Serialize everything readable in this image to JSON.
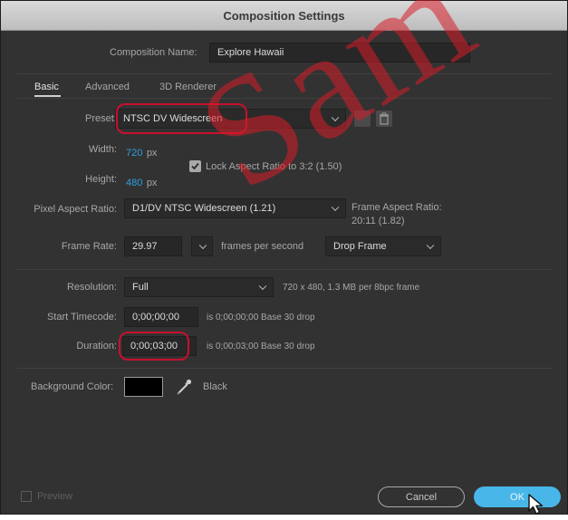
{
  "window": {
    "title": "Composition Settings"
  },
  "composition_name": {
    "label": "Composition Name:",
    "value": "Explore Hawaii"
  },
  "tabs": [
    {
      "label": "Basic",
      "active": true
    },
    {
      "label": "Advanced",
      "active": false
    },
    {
      "label": "3D Renderer",
      "active": false
    }
  ],
  "preset": {
    "label": "Preset:",
    "value": "NTSC DV Widescreen"
  },
  "width": {
    "label": "Width:",
    "value": "720",
    "unit": "px"
  },
  "height": {
    "label": "Height:",
    "value": "480",
    "unit": "px"
  },
  "lock_aspect": {
    "label": "Lock Aspect Ratio to 3:2 (1.50)",
    "checked": true
  },
  "pixel_aspect": {
    "label": "Pixel Aspect Ratio:",
    "value": "D1/DV NTSC Widescreen (1.21)"
  },
  "frame_aspect": {
    "label": "Frame Aspect Ratio:",
    "value": "20:11 (1.82)"
  },
  "frame_rate": {
    "label": "Frame Rate:",
    "value": "29.97",
    "unit": "frames per second",
    "drop_value": "Drop Frame"
  },
  "resolution": {
    "label": "Resolution:",
    "value": "Full",
    "info": "720 x 480, 1.3 MB per 8bpc frame"
  },
  "start_timecode": {
    "label": "Start Timecode:",
    "value": "0;00;00;00",
    "info": "is 0;00;00;00  Base 30  drop"
  },
  "duration": {
    "label": "Duration:",
    "value": "0;00;03;00",
    "info": "is 0;00;03;00  Base 30  drop"
  },
  "background": {
    "label": "Background Color:",
    "color_name": "Black",
    "swatch": "#000000"
  },
  "footer": {
    "preview_label": "Preview",
    "cancel_label": "Cancel",
    "ok_label": "OK"
  },
  "watermark": "Sam",
  "colors": {
    "highlight": "#c8102e",
    "ok_button": "#48b6e8",
    "link_blue": "#2f9fe0"
  },
  "icons": [
    "eyedropper-icon",
    "save-preset-icon",
    "delete-preset-icon",
    "checkbox-checked-icon",
    "mouse-cursor-icon"
  ]
}
